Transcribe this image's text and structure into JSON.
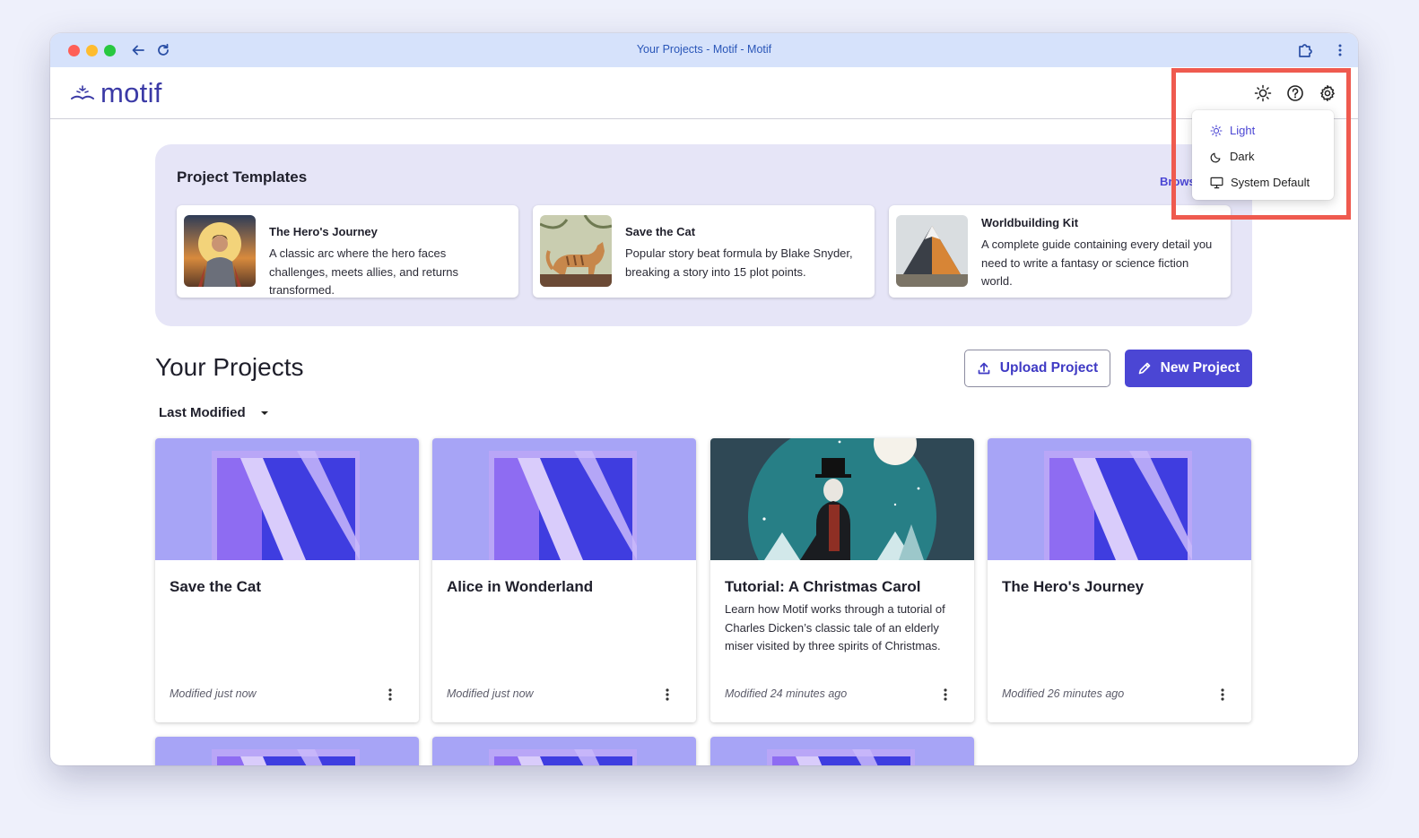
{
  "window": {
    "title": "Your Projects - Motif - Motif"
  },
  "header": {
    "logo_text": "motif"
  },
  "theme_menu": {
    "items": [
      {
        "label": "Light",
        "icon": "sun-icon",
        "active": true
      },
      {
        "label": "Dark",
        "icon": "moon-icon",
        "active": false
      },
      {
        "label": "System Default",
        "icon": "monitor-icon",
        "active": false
      }
    ]
  },
  "templates": {
    "title": "Project Templates",
    "browse_label": "Brows",
    "items": [
      {
        "name": "The Hero's Journey",
        "description": "A classic arc where the hero faces challenges, meets allies, and returns transformed."
      },
      {
        "name": "Save the Cat",
        "description": "Popular story beat formula by Blake Snyder, breaking a story into 15 plot points."
      },
      {
        "name": "Worldbuilding Kit",
        "description": "A complete guide containing every detail you need to write a fantasy or science fiction world."
      }
    ]
  },
  "projects": {
    "title": "Your Projects",
    "upload_label": "Upload Project",
    "new_label": "New Project",
    "sort_label": "Last Modified",
    "items": [
      {
        "name": "Save the Cat",
        "description": "",
        "modified": "Modified just now"
      },
      {
        "name": "Alice in Wonderland",
        "description": "",
        "modified": "Modified just now"
      },
      {
        "name": "Tutorial: A Christmas Carol",
        "description": "Learn how Motif works through a tutorial of Charles Dicken’s classic tale of an elderly miser visited by three spirits of Christmas.",
        "modified": "Modified 24 minutes ago"
      },
      {
        "name": "The Hero's Journey",
        "description": "",
        "modified": "Modified 26 minutes ago"
      }
    ]
  },
  "colors": {
    "accent": "#4b46d4",
    "highlight": "#ef5a4f",
    "book_bg": "#a7a4f6"
  }
}
